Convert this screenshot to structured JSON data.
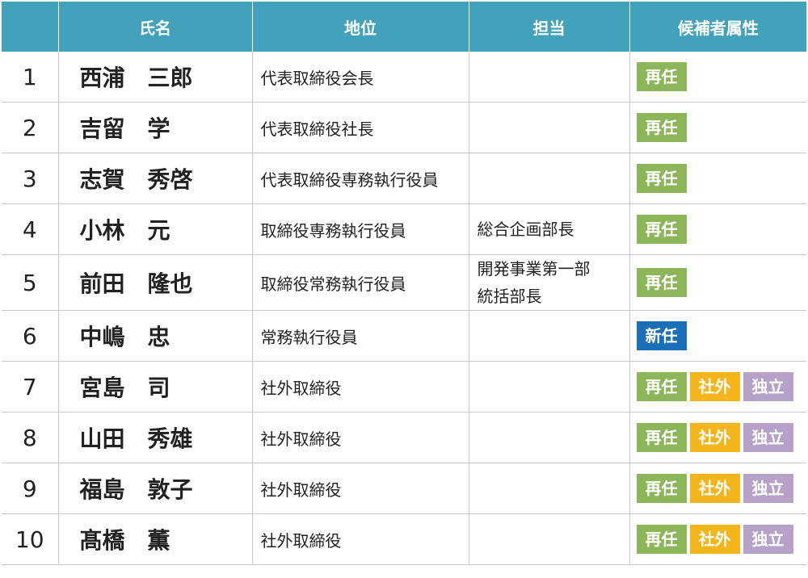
{
  "headers": [
    "",
    "氏名",
    "地位",
    "担当",
    "候補者属性"
  ],
  "rows": [
    {
      "no": "1",
      "name": "西浦　三郎",
      "position": "代表取締役会長",
      "role": "",
      "attributes": [
        "再任"
      ]
    },
    {
      "no": "2",
      "name": "吉留　学",
      "position": "代表取締役社長",
      "role": "",
      "attributes": [
        "再任"
      ]
    },
    {
      "no": "3",
      "name": "志賀　秀啓",
      "position": "代表取締役専務執行役員",
      "role": "",
      "attributes": [
        "再任"
      ]
    },
    {
      "no": "4",
      "name": "小林　元",
      "position": "取締役専務執行役員",
      "role": "総合企画部長",
      "attributes": [
        "再任"
      ]
    },
    {
      "no": "5",
      "name": "前田　隆也",
      "position": "取締役常務執行役員",
      "role": "開発事業第一部\n統括部長",
      "attributes": [
        "再任"
      ]
    },
    {
      "no": "6",
      "name": "中嶋　忠",
      "position": "常務執行役員",
      "role": "",
      "attributes": [
        "新任"
      ]
    },
    {
      "no": "7",
      "name": "宮島　司",
      "position": "社外取締役",
      "role": "",
      "attributes": [
        "再任",
        "社外",
        "独立"
      ]
    },
    {
      "no": "8",
      "name": "山田　秀雄",
      "position": "社外取締役",
      "role": "",
      "attributes": [
        "再任",
        "社外",
        "独立"
      ]
    },
    {
      "no": "9",
      "name": "福島　敦子",
      "position": "社外取締役",
      "role": "",
      "attributes": [
        "再任",
        "社外",
        "独立"
      ]
    },
    {
      "no": "10",
      "name": "髙橋　薫",
      "position": "社外取締役",
      "role": "",
      "attributes": [
        "再任",
        "社外",
        "独立"
      ]
    }
  ],
  "colors": {
    "header_bg": "#42a1bb",
    "badge_reappoint": "#8db55a",
    "badge_outside": "#f4b41c",
    "badge_independent": "#b6a2c9",
    "badge_new": "#1a6fb8"
  }
}
